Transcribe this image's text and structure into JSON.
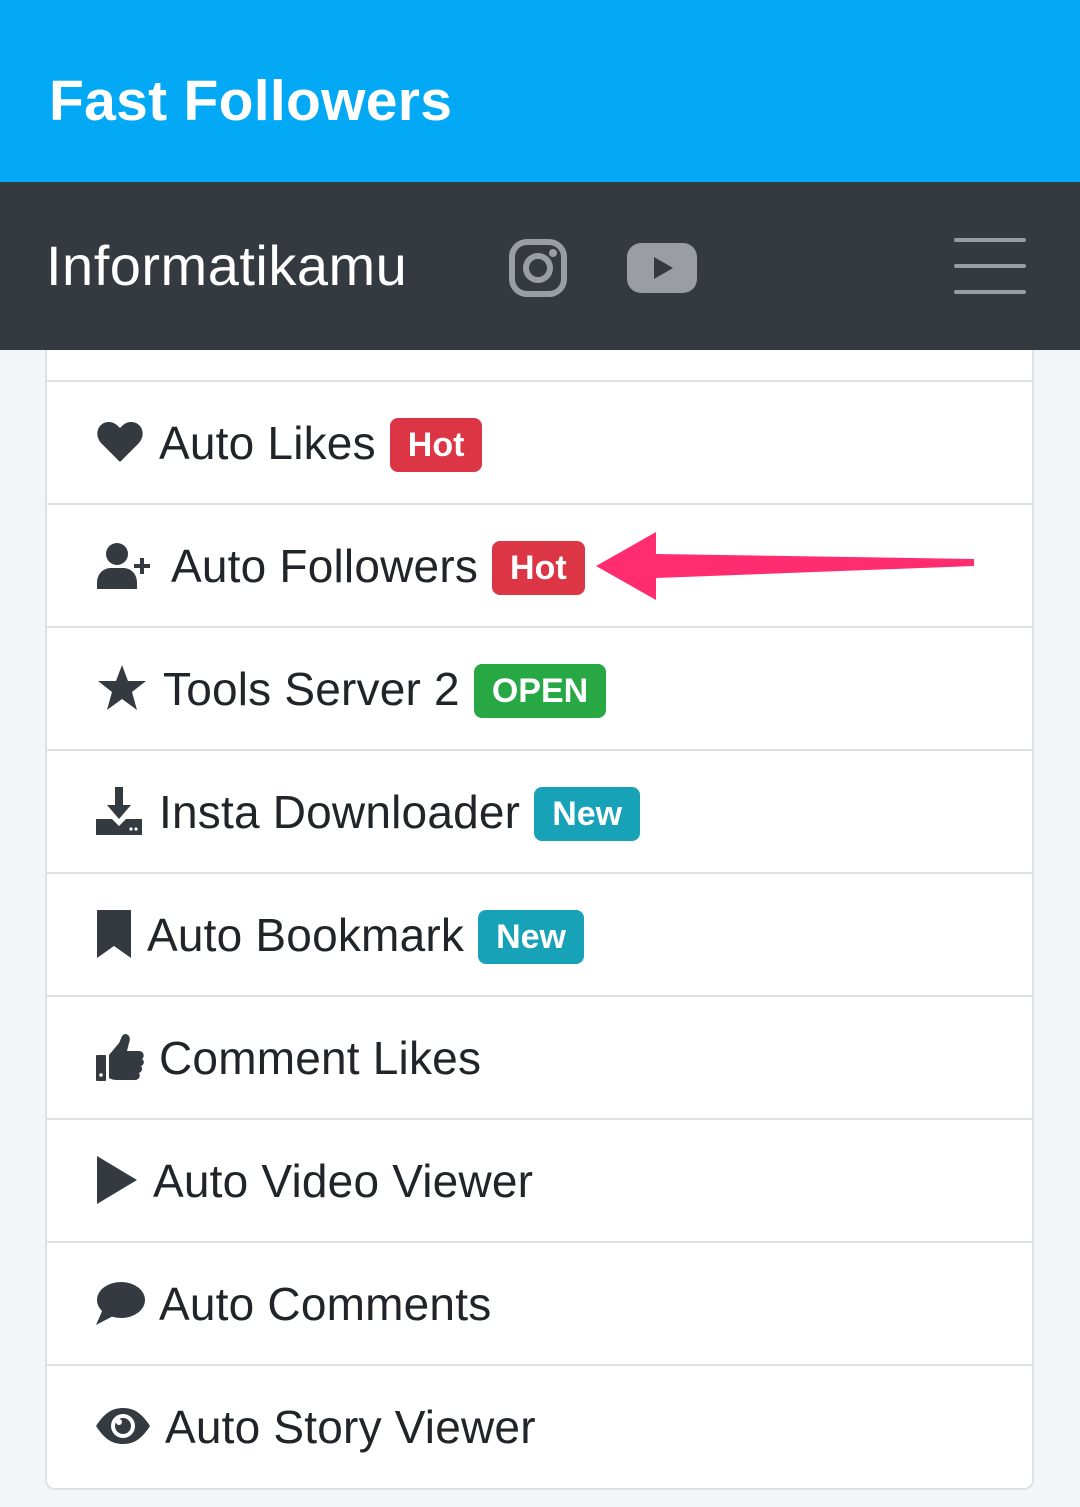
{
  "app_bar": {
    "title": "Fast Followers"
  },
  "navbar": {
    "brand": "Informatikamu",
    "icons": [
      "instagram-icon",
      "youtube-icon",
      "hamburger-menu-icon"
    ]
  },
  "colors": {
    "app_bar": "#03a9f4",
    "navbar": "#343a40",
    "badge_hot": "#dc3545",
    "badge_open": "#28a745",
    "badge_new": "#17a2b8",
    "annotation_arrow": "#ff2d6f"
  },
  "menu": {
    "items": [
      {
        "icon": "heart-icon",
        "label": "Auto Likes",
        "badge": "Hot",
        "badge_type": "hot"
      },
      {
        "icon": "user-plus-icon",
        "label": "Auto Followers",
        "badge": "Hot",
        "badge_type": "hot"
      },
      {
        "icon": "star-icon",
        "label": "Tools Server 2",
        "badge": "OPEN",
        "badge_type": "open"
      },
      {
        "icon": "download-icon",
        "label": "Insta Downloader",
        "badge": "New",
        "badge_type": "new"
      },
      {
        "icon": "bookmark-icon",
        "label": "Auto Bookmark",
        "badge": "New",
        "badge_type": "new"
      },
      {
        "icon": "thumbs-up-icon",
        "label": "Comment Likes"
      },
      {
        "icon": "play-icon",
        "label": "Auto Video Viewer"
      },
      {
        "icon": "comment-icon",
        "label": "Auto Comments"
      },
      {
        "icon": "eye-icon",
        "label": "Auto Story Viewer"
      }
    ]
  }
}
